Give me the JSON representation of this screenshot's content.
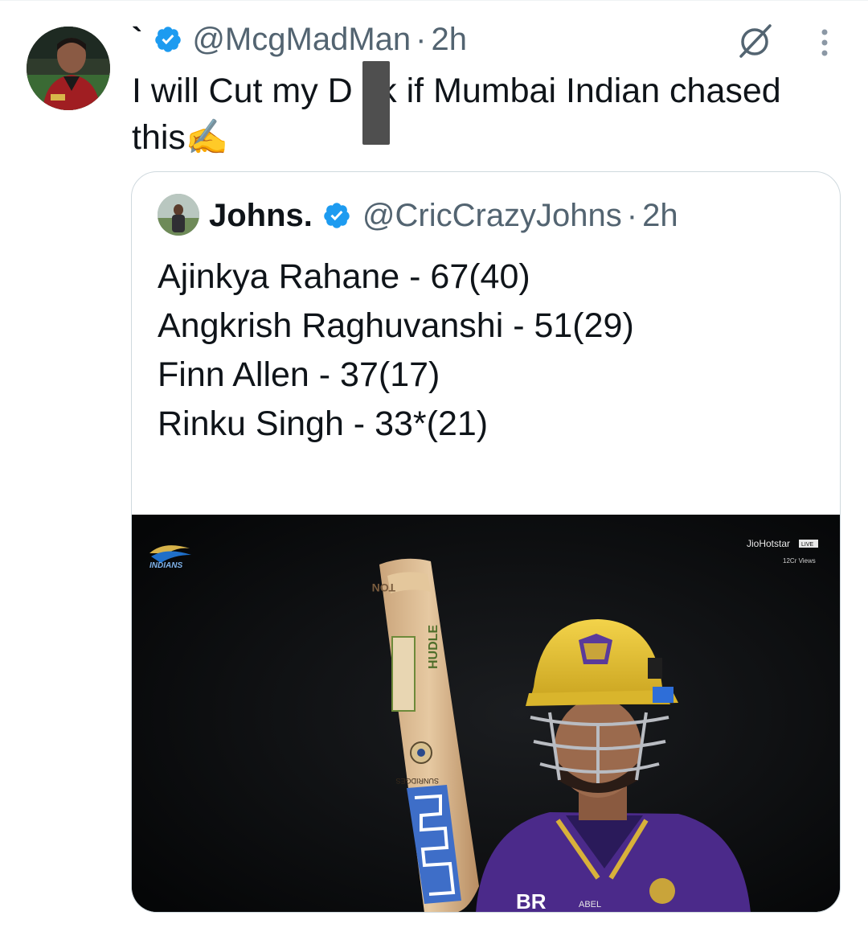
{
  "tweet": {
    "display_name": "`",
    "handle": "@McgMadMan",
    "separator": "·",
    "time": "2h",
    "text": "I will Cut my D  ck if Mumbai Indian chased this✍️",
    "icons": {
      "verified": "verified-badge-icon",
      "grok": "grok-icon",
      "more": "more-options-icon"
    },
    "colors": {
      "verified": "#1d9bf0",
      "secondary_text": "#536471",
      "primary_text": "#0f1419",
      "border": "#cfd9de"
    }
  },
  "quote": {
    "display_name": "Johns.",
    "handle": "@CricCrazyJohns",
    "separator": "·",
    "time": "2h",
    "lines": [
      "Ajinkya Rahane - 67(40)",
      "Angkrish Raghuvanshi - 51(29)",
      "Finn Allen - 37(17)",
      "Rinku Singh - 33*(21)"
    ],
    "ellipsis": "...",
    "media": {
      "logo_text": "INDIANS",
      "broadcaster": "JioHotstar",
      "live_badge": "LIVE",
      "views": "12Cr Views",
      "bat_label_top": "TON",
      "bat_label_brand": "HUDLE",
      "bat_label_sponsor": "SUNRIDGES",
      "jersey_text": "BR",
      "jersey_sponsor": "ABEL"
    }
  }
}
